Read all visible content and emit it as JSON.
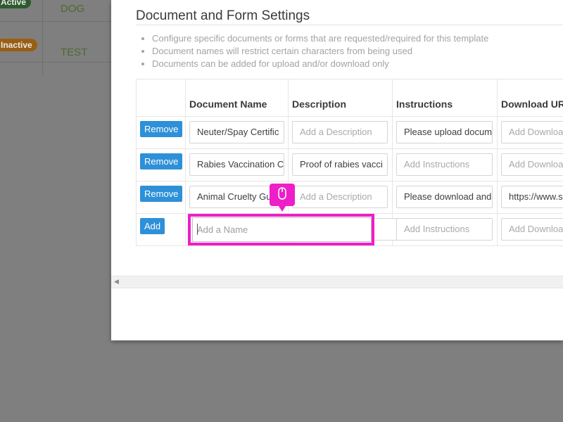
{
  "background": {
    "rows": [
      {
        "status": "Active",
        "value": "DOG"
      },
      {
        "status": "Inactive",
        "value": "TEST"
      }
    ]
  },
  "modal": {
    "title": "Document and Form Settings",
    "notes": [
      "Configure specific documents or forms that are requested/required for this template",
      "Document names will restrict certain characters from being used",
      "Documents can be added for upload and/or download only"
    ],
    "table": {
      "headers": [
        "Document Name",
        "Description",
        "Instructions",
        "Download UR"
      ],
      "rows": [
        {
          "button": "Remove",
          "name": "Neuter/Spay Certific",
          "description": "Add a Description",
          "instructions": "Please upload docum",
          "download": "Add Downloa"
        },
        {
          "button": "Remove",
          "name": "Rabies Vaccination C",
          "description": "Proof of rabies vacci",
          "instructions": "Add Instructions",
          "download": "Add Downloa"
        },
        {
          "button": "Remove",
          "name": "Animal Cruelty Gu",
          "description": "Add a Description",
          "instructions": "Please download and",
          "download": "https://www.s"
        }
      ],
      "new_row": {
        "button": "Add",
        "name_placeholder": "Add a Name",
        "instructions": "Add Instructions",
        "download": "Add Downloa"
      }
    }
  },
  "colors": {
    "highlight": "#ee1ec8",
    "button": "#2e90d8"
  },
  "icons": {
    "cursor": "mouse-icon",
    "scroll": "scroll-left-arrow-icon"
  }
}
